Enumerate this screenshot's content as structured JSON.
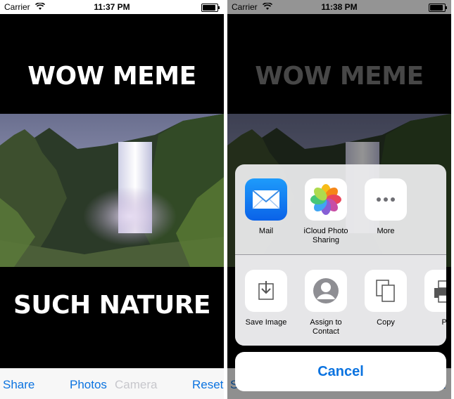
{
  "left": {
    "status": {
      "carrier": "Carrier",
      "time": "11:37 PM"
    },
    "meme": {
      "top": "WOW MEME",
      "bottom": "SUCH NATURE"
    },
    "toolbar": {
      "share": "Share",
      "photos": "Photos",
      "camera": "Camera",
      "reset": "Reset"
    }
  },
  "right": {
    "status": {
      "carrier": "Carrier",
      "time": "11:38 PM"
    },
    "meme": {
      "top": "WOW MEME"
    },
    "toolbar": {
      "share_partial": "S",
      "reset_partial": "t"
    },
    "share_sheet": {
      "apps": [
        {
          "label": "Mail",
          "icon": "mail-icon"
        },
        {
          "label": "iCloud Photo\nSharing",
          "icon": "photos-icon"
        },
        {
          "label": "More",
          "icon": "more-icon"
        }
      ],
      "actions": [
        {
          "label": "Save Image",
          "icon": "save-image-icon"
        },
        {
          "label": "Assign to\nContact",
          "icon": "contact-icon"
        },
        {
          "label": "Copy",
          "icon": "copy-icon"
        },
        {
          "label": "Pr",
          "icon": "print-icon"
        }
      ],
      "cancel": "Cancel"
    }
  },
  "colors": {
    "accent": "#0b73e0",
    "background": "#000000",
    "toolbar": "#f7f7f7"
  }
}
